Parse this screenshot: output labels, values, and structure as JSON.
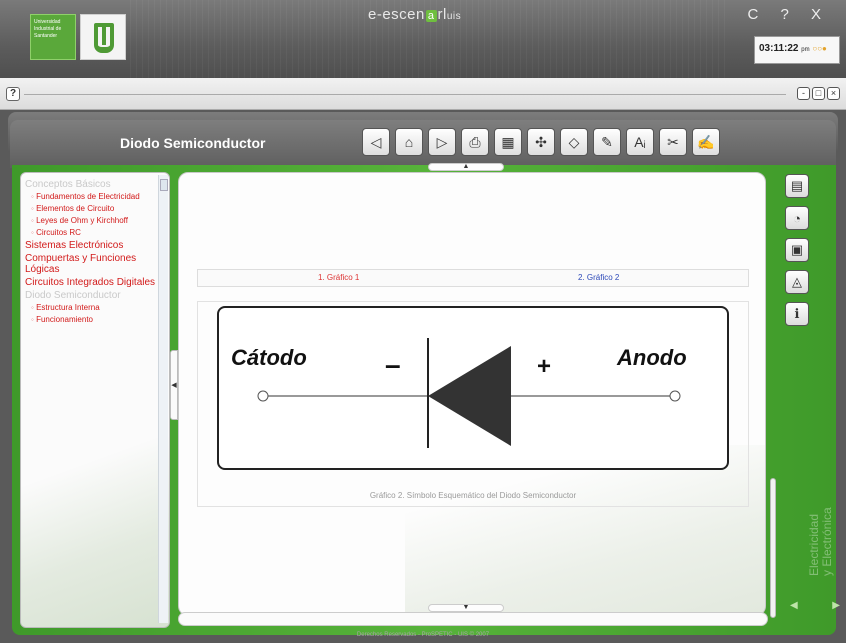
{
  "header": {
    "logo_text": "Universidad Industrial de Santander",
    "brand_left": "e-escen",
    "brand_box": "a",
    "brand_right": "rl",
    "brand_suffix": "uis",
    "window_controls": "C ? X",
    "clock": "03:11:22",
    "clock_period": "pm"
  },
  "strip": {
    "help": "?"
  },
  "title": "Diodo Semiconductor",
  "nav_icons": [
    "prev-icon",
    "home-icon",
    "next-icon",
    "print-icon",
    "calculator-icon",
    "molecule-icon",
    "eraser-icon",
    "notes-icon",
    "glossary-icon",
    "tools-icon",
    "exercise-icon"
  ],
  "menu": {
    "sec1": "Conceptos Básicos",
    "sec1_items": [
      "Fundamentos de Electricidad",
      "Elementos de Circuito",
      "Leyes de Ohm y Kirchhoff",
      "Circuitos RC"
    ],
    "sec2": "Sistemas Electrónicos",
    "sec3": "Compuertas y Funciones Lógicas",
    "sec4": "Circuitos Integrados Digitales",
    "sec5": "Diodo Semiconductor",
    "sec5_items": [
      "Estructura Interna",
      "Funcionamiento"
    ]
  },
  "tabs": {
    "tab1": "1. Gráfico 1",
    "tab2": "2. Gráfico 2"
  },
  "diagram": {
    "cathode": "Cátodo",
    "anode": "Anodo",
    "minus": "–",
    "plus": "+"
  },
  "caption": "Gráfico 2. Símbolo Esquemático del Diodo Semiconductor",
  "side_text_1": "Electricidad",
  "side_text_2": "y Electrónica",
  "footer": "Derechos Reservados - ProSPETIC - UIS © 2007"
}
